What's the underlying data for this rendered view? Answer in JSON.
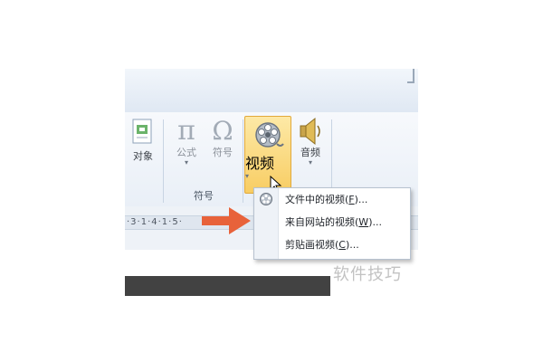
{
  "ribbon": {
    "object_label": "对象",
    "formula_label": "公式",
    "symbol_label": "符号",
    "video_label": "视频",
    "audio_label": "音频",
    "group_symbols_label": "符号"
  },
  "ruler": {
    "text": "·3·1·4·1·5·"
  },
  "menu": {
    "items": [
      {
        "label": "文件中的视频(",
        "key": "F",
        "suffix": ")..."
      },
      {
        "label": "来自网站的视频(",
        "key": "W",
        "suffix": ")..."
      },
      {
        "label": "剪贴画视频(",
        "key": "C",
        "suffix": ")..."
      }
    ]
  },
  "watermark": {
    "text": "软件技巧"
  },
  "colors": {
    "highlight": "#f8cd63",
    "arrow": "#e8623a",
    "dark_bar": "#424242"
  },
  "icons": [
    "object-icon",
    "pi-icon",
    "omega-icon",
    "film-reel-icon",
    "speaker-icon",
    "mouse-cursor-icon",
    "arrow-right-icon"
  ]
}
